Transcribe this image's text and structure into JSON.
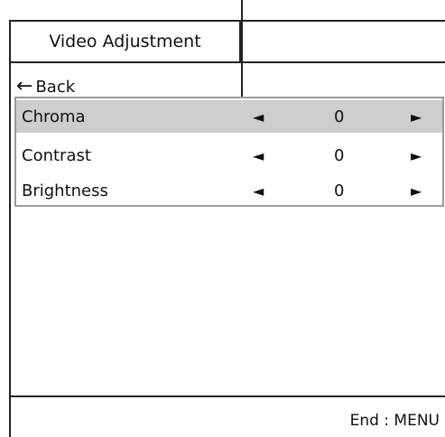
{
  "window": {
    "title": "Video Adjustment"
  },
  "nav": {
    "back_label": "Back",
    "back_icon": "left-arrow-icon"
  },
  "settings": [
    {
      "label": "Chroma",
      "value": "0",
      "selected": true
    },
    {
      "label": "Contrast",
      "value": "0",
      "selected": false
    },
    {
      "label": "Brightness",
      "value": "0",
      "selected": false
    }
  ],
  "glyphs": {
    "decrease": "◄",
    "increase": "►",
    "back_arrow": "🡐"
  },
  "footer": {
    "end_hint": "End : MENU"
  },
  "colors": {
    "selected_row": "#cdcdcd",
    "list_border": "#9a9a9a",
    "frame": "#222222"
  }
}
